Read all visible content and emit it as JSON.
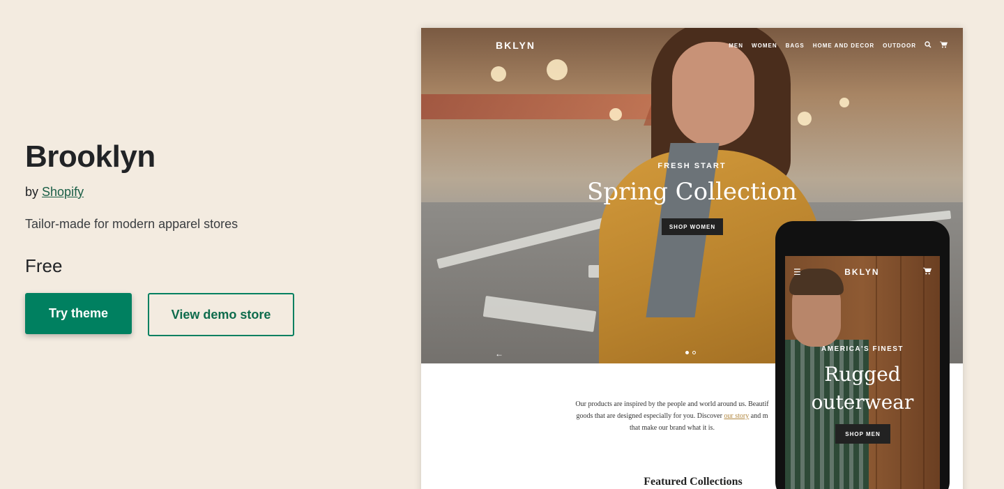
{
  "theme": {
    "name": "Brooklyn",
    "by_prefix": "by",
    "author": "Shopify",
    "tagline": "Tailor-made for modern apparel stores",
    "price": "Free",
    "try_label": "Try theme",
    "demo_label": "View demo store"
  },
  "desktop_preview": {
    "brand": "BKLYN",
    "menu": [
      "MEN",
      "WOMEN",
      "BAGS",
      "HOME AND DECOR",
      "OUTDOOR"
    ],
    "eyebrow": "FRESH START",
    "headline": "Spring Collection",
    "cta": "SHOP WOMEN",
    "intro_before": "Our products are inspired by the people and world around us. Beautif",
    "intro_line2_before": "goods that are designed especially for you. Discover ",
    "intro_link": "our story",
    "intro_line2_after": " and m",
    "intro_line3": "that make our brand what it is.",
    "featured": "Featured Collections"
  },
  "mobile_preview": {
    "brand": "BKLYN",
    "eyebrow": "AMERICA'S FINEST",
    "headline_line1": "Rugged",
    "headline_line2": "outerwear",
    "cta": "SHOP MEN"
  },
  "colors": {
    "background": "#f3ebe0",
    "primary": "#008060"
  },
  "icons": [
    "search-icon",
    "cart-icon",
    "hamburger-icon",
    "arrow-left-icon"
  ]
}
